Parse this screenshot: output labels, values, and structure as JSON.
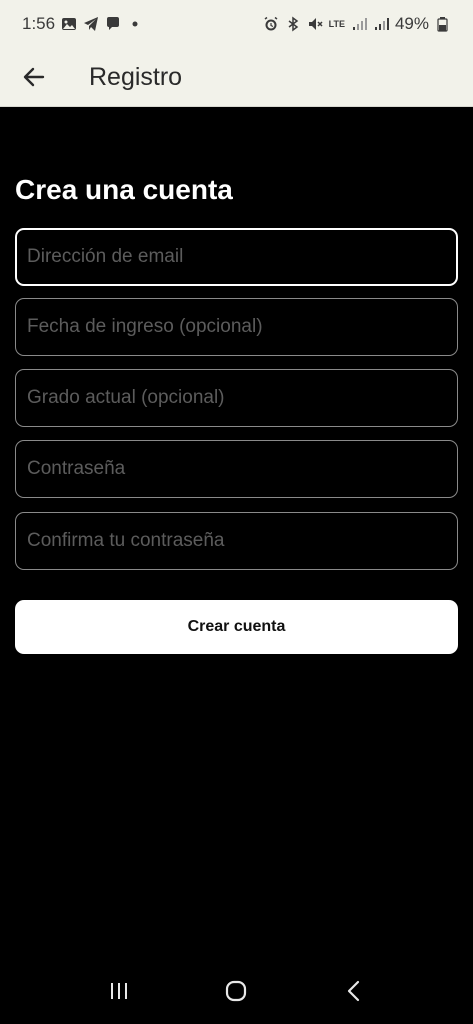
{
  "status_bar": {
    "time": "1:56",
    "lte_label": "LTE",
    "battery": "49%",
    "icons": [
      "image-icon",
      "telegram-icon",
      "chat-icon",
      "dot-icon",
      "alarm-icon",
      "bluetooth-icon",
      "mute-icon",
      "signal-icon",
      "battery-icon"
    ]
  },
  "app_bar": {
    "title": "Registro",
    "back_icon": "arrow-left-icon"
  },
  "form": {
    "heading": "Crea una cuenta",
    "email_placeholder": "Dirección de email",
    "email_value": "",
    "entry_date_placeholder": "Fecha de ingreso (opcional)",
    "entry_date_value": "",
    "grade_placeholder": "Grado actual (opcional)",
    "grade_value": "",
    "password_placeholder": "Contraseña",
    "password_value": "",
    "confirm_password_placeholder": "Confirma tu contraseña",
    "confirm_password_value": "",
    "submit_label": "Crear cuenta"
  },
  "nav_bar": {
    "icons": [
      "recents-icon",
      "home-icon",
      "back-icon"
    ]
  },
  "colors": {
    "background": "#000000",
    "app_bar": "#f2f2ea",
    "primary_button": "#ffffff",
    "field_border": "#8a8a8a",
    "placeholder": "#5c5c5c"
  }
}
